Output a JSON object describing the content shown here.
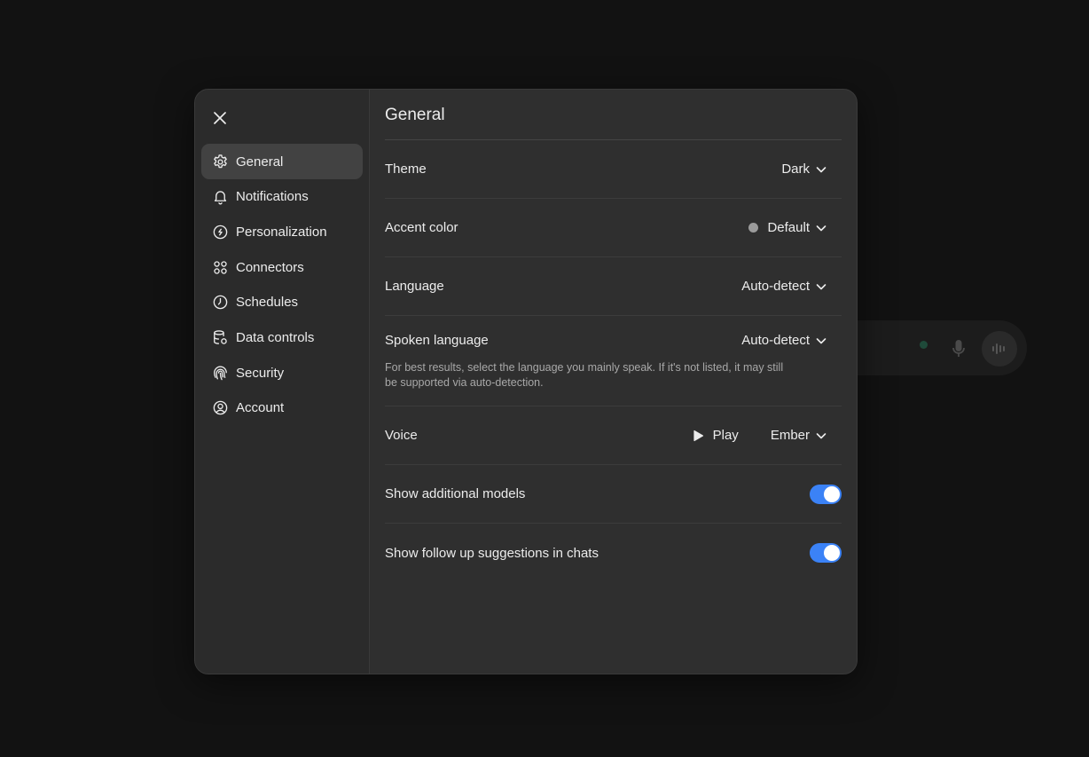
{
  "settings": {
    "title": "General",
    "nav": [
      {
        "label": "General",
        "icon": "gear-icon",
        "active": true
      },
      {
        "label": "Notifications",
        "icon": "bell-icon"
      },
      {
        "label": "Personalization",
        "icon": "personalization-icon"
      },
      {
        "label": "Connectors",
        "icon": "connectors-icon"
      },
      {
        "label": "Schedules",
        "icon": "clock-icon"
      },
      {
        "label": "Data controls",
        "icon": "database-icon"
      },
      {
        "label": "Security",
        "icon": "fingerprint-icon"
      },
      {
        "label": "Account",
        "icon": "account-icon"
      }
    ],
    "rows": {
      "theme": {
        "label": "Theme",
        "value": "Dark"
      },
      "accent": {
        "label": "Accent color",
        "value": "Default",
        "dot_color": "#9b9b9b"
      },
      "language": {
        "label": "Language",
        "value": "Auto-detect"
      },
      "spoken": {
        "label": "Spoken language",
        "value": "Auto-detect",
        "hint": "For best results, select the language you mainly speak. If it's not listed, it may still be supported via auto-detection."
      },
      "voice": {
        "label": "Voice",
        "play_label": "Play",
        "value": "Ember"
      },
      "additional_models": {
        "label": "Show additional models",
        "enabled": true
      },
      "follow_up": {
        "label": "Show follow up suggestions in chats",
        "enabled": true
      }
    }
  },
  "colors": {
    "toggle_on": "#3b82f6",
    "background": "#121212",
    "modal": "#2f2f2f"
  }
}
